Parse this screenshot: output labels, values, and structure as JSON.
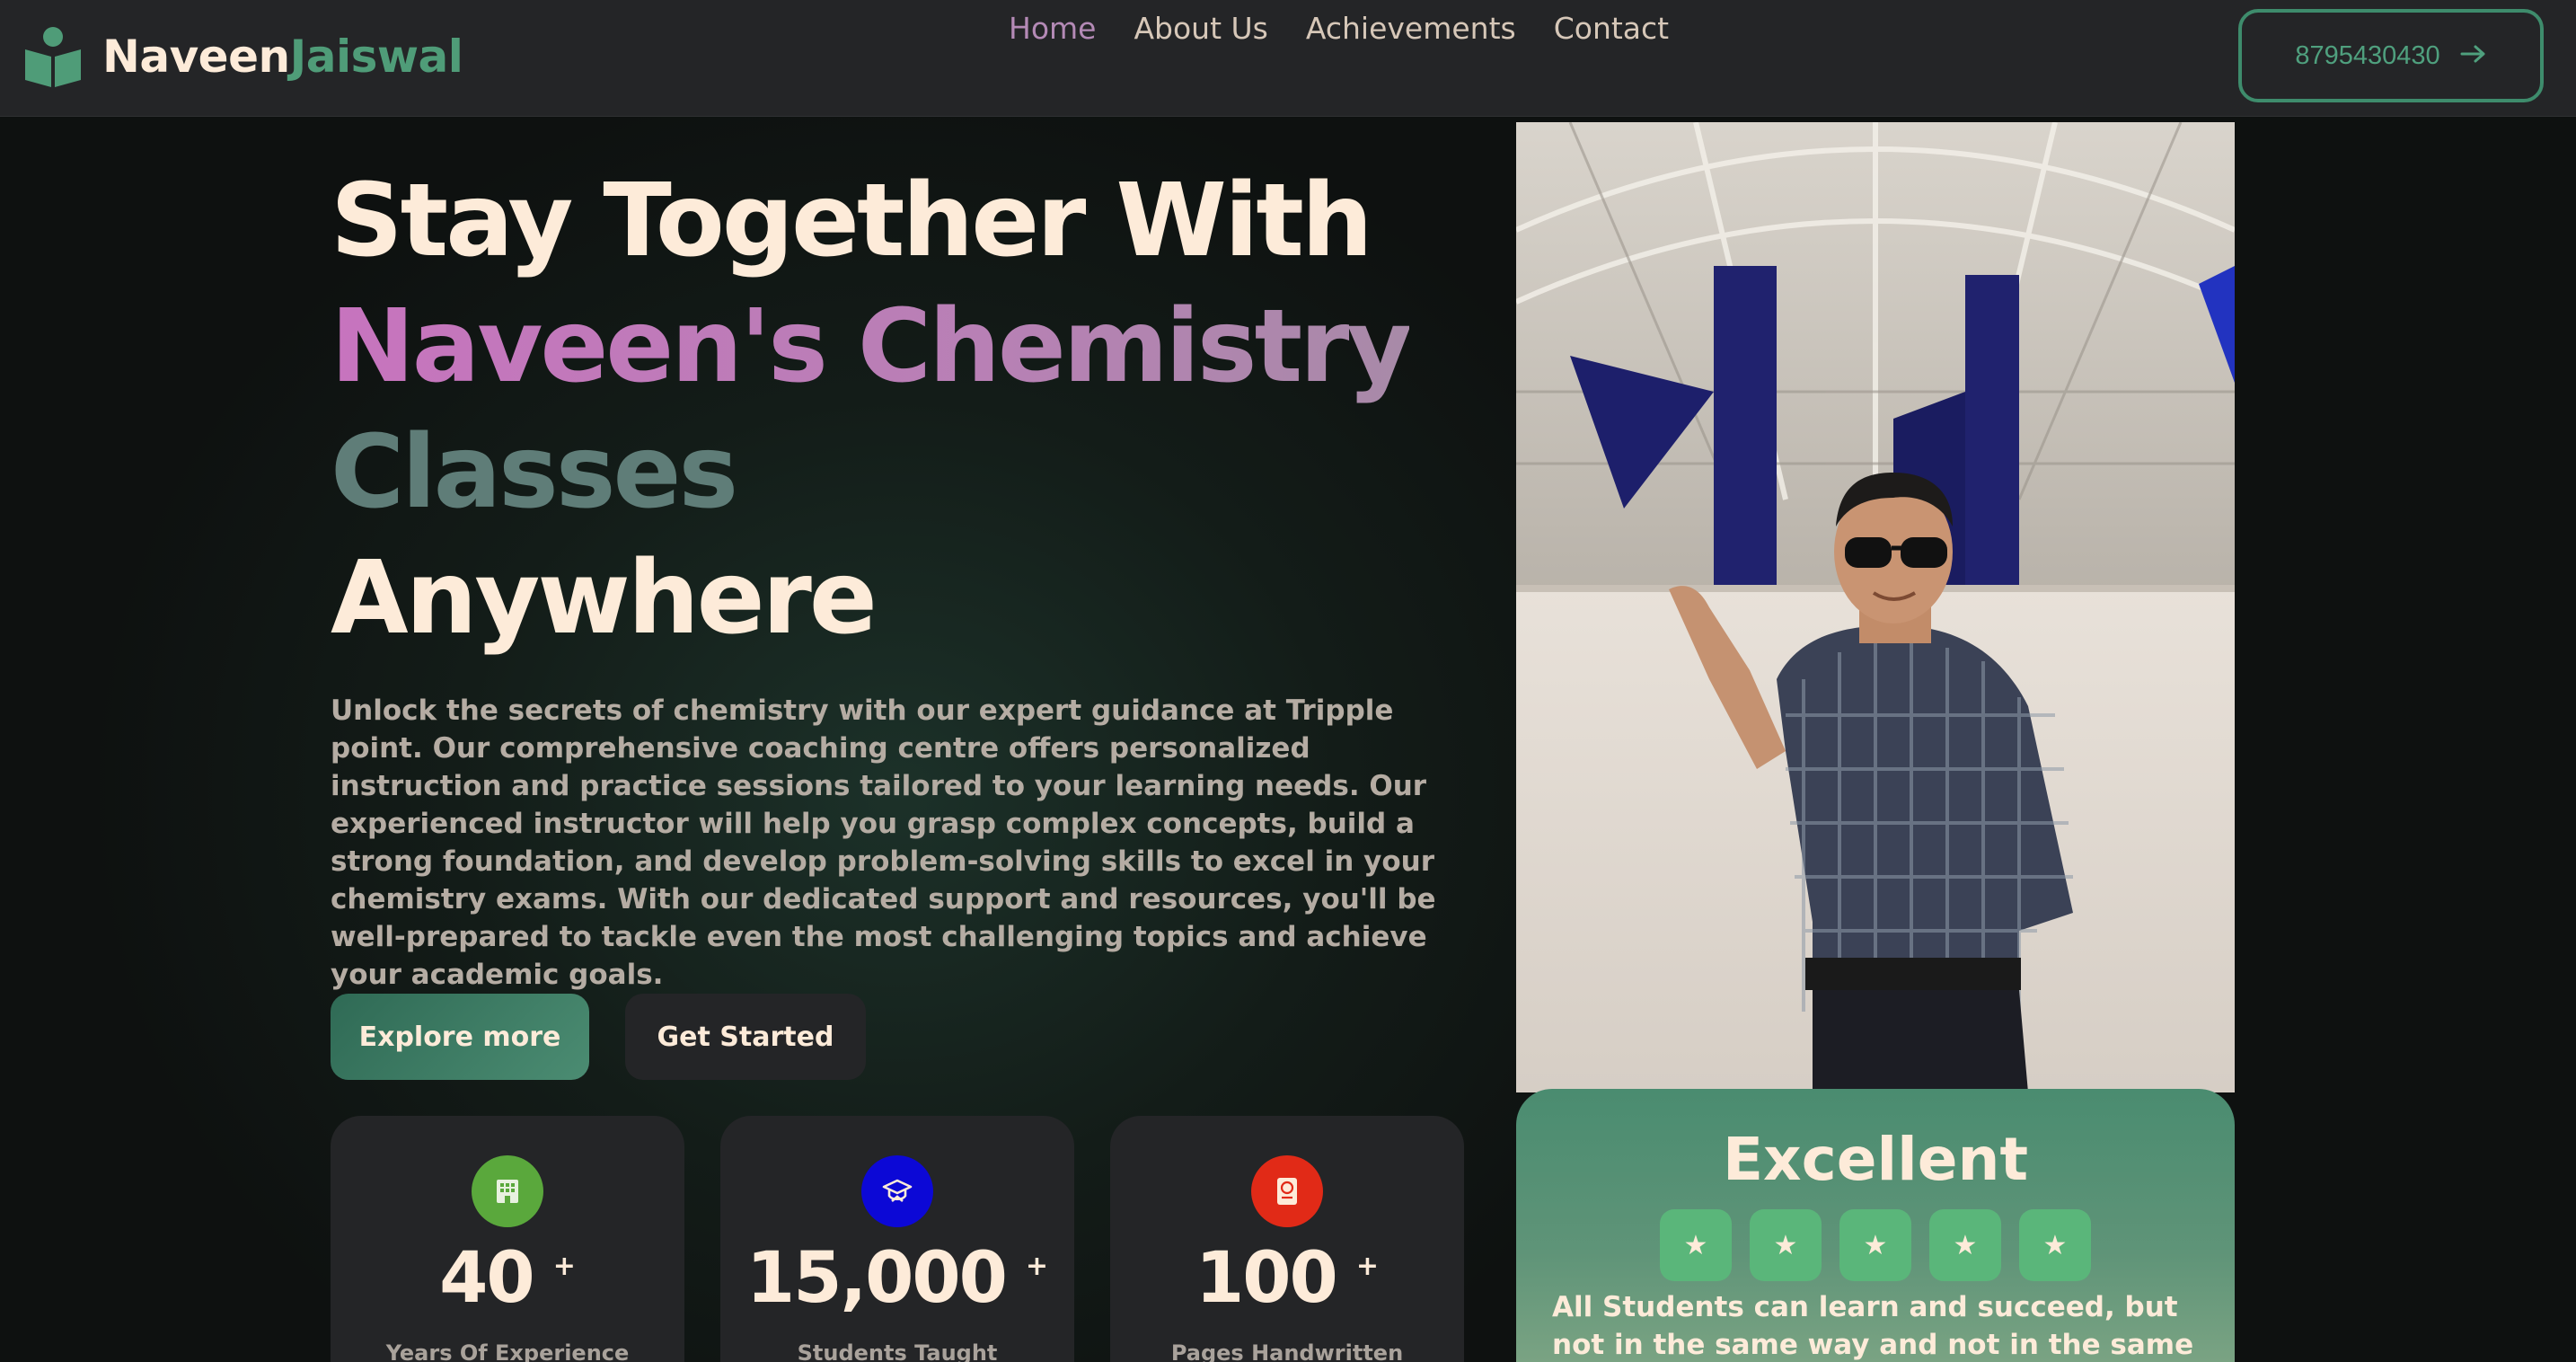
{
  "brand": {
    "first": "Naveen",
    "last": "Jaiswal",
    "icon": "book-reader-icon"
  },
  "nav": {
    "items": [
      {
        "label": "Home",
        "active": true
      },
      {
        "label": "About Us",
        "active": false
      },
      {
        "label": "Achievements",
        "active": false
      },
      {
        "label": "Contact",
        "active": false
      }
    ],
    "phone": "8795430430",
    "phone_icon": "arrow-right-icon"
  },
  "hero": {
    "line1": "Stay Together With",
    "line2": "Naveen's Chemistry",
    "line3": "Classes",
    "line4": "Anywhere",
    "description": "Unlock the secrets of chemistry with our expert guidance at Tripple point. Our comprehensive coaching centre offers personalized instruction and practice sessions tailored to your learning needs. Our experienced instructor will help you grasp complex concepts, build a strong foundation, and develop problem-solving skills to excel in your chemistry exams. With our dedicated support and resources, you'll be well-prepared to tackle even the most challenging topics and achieve your academic goals.",
    "explore_label": "Explore more",
    "start_label": "Get Started"
  },
  "stats": [
    {
      "value": "40",
      "suffix": "+",
      "label": "Years Of Experience",
      "icon": "building-icon",
      "color": "#5aa83c"
    },
    {
      "value": "15,000",
      "suffix": "+",
      "label": "Students Taught",
      "icon": "graduation-cap-icon",
      "color": "#0c08d6"
    },
    {
      "value": "100",
      "suffix": "+",
      "label": "Pages Handwritten",
      "icon": "book-icon",
      "color": "#e12a17"
    }
  ],
  "review": {
    "title": "Excellent",
    "stars": 5,
    "text": "All Students can learn and succeed, but not in the same way and not in the same day."
  },
  "colors": {
    "accent": "#4f9c78",
    "cream": "#fdebd9",
    "pink": "#c774be",
    "nav_bg": "#242527"
  }
}
